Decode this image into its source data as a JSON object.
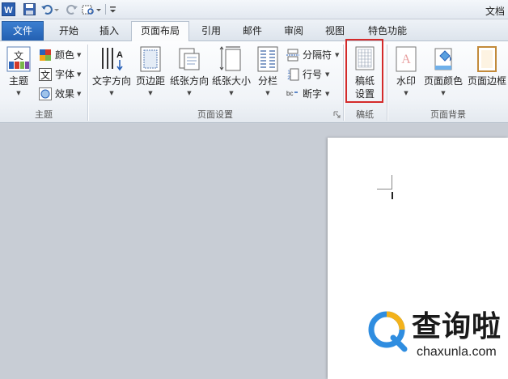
{
  "window": {
    "title": "文档"
  },
  "tabs": [
    {
      "id": "file",
      "label": "文件"
    },
    {
      "id": "home",
      "label": "开始"
    },
    {
      "id": "insert",
      "label": "插入"
    },
    {
      "id": "layout",
      "label": "页面布局"
    },
    {
      "id": "references",
      "label": "引用"
    },
    {
      "id": "mailings",
      "label": "邮件"
    },
    {
      "id": "review",
      "label": "审阅"
    },
    {
      "id": "view",
      "label": "视图"
    },
    {
      "id": "special",
      "label": "特色功能"
    }
  ],
  "active_tab": "页面布局",
  "ribbon": {
    "themes": {
      "group_label": "主题",
      "theme_button": "主题",
      "colors": "颜色",
      "fonts": "字体",
      "effects": "效果"
    },
    "page_setup": {
      "group_label": "页面设置",
      "text_direction": "文字方向",
      "margins": "页边距",
      "orientation": "纸张方向",
      "size": "纸张大小",
      "columns": "分栏",
      "breaks": "分隔符",
      "line_numbers": "行号",
      "hyphenation": "断字"
    },
    "manuscript": {
      "group_label": "稿纸",
      "button_line1": "稿纸",
      "button_line2": "设置"
    },
    "page_background": {
      "group_label": "页面背景",
      "watermark": "水印",
      "page_color": "页面颜色",
      "page_borders": "页面边框"
    }
  },
  "watermark_overlay": {
    "chinese": "查询啦",
    "domain": "chaxunla.com"
  },
  "colors": {
    "file_tab": "#2b6cc4",
    "highlight_border": "#d42a2a",
    "workspace": "#c8cdd5"
  }
}
